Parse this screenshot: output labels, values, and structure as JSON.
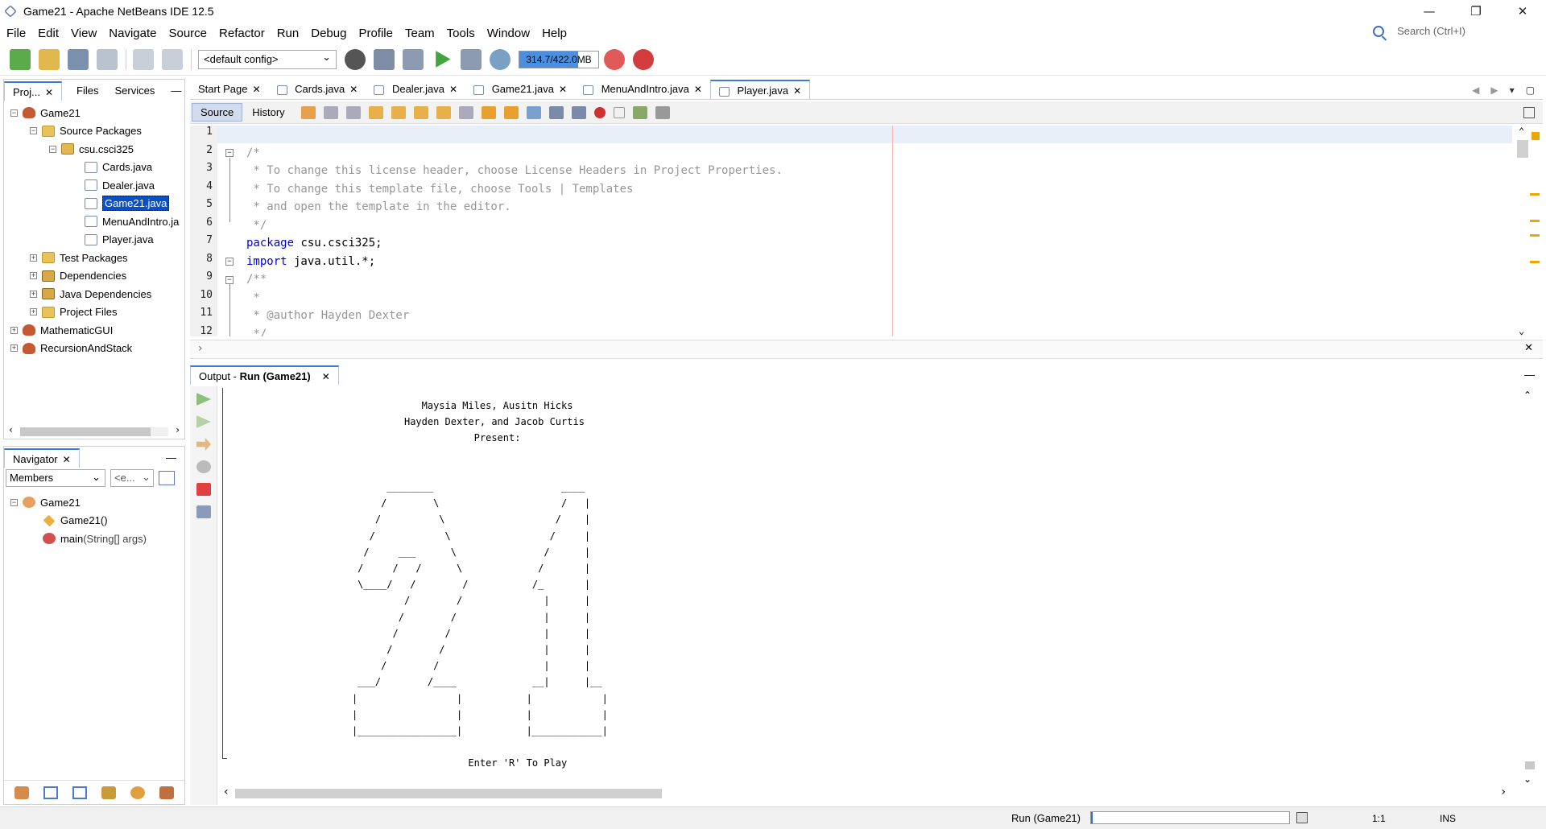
{
  "window": {
    "title": "Game21 - Apache NetBeans IDE 12.5",
    "minimize": "—",
    "maximize": "❐",
    "close": "✕"
  },
  "menu": [
    "File",
    "Edit",
    "View",
    "Navigate",
    "Source",
    "Refactor",
    "Run",
    "Debug",
    "Profile",
    "Team",
    "Tools",
    "Window",
    "Help"
  ],
  "search": {
    "placeholder": "Search (Ctrl+I)"
  },
  "toolbar": {
    "config": "<default config>",
    "memory_label": "314.7/422.0MB",
    "memory_fraction": 0.746
  },
  "project_tabs": {
    "projects": "Proj...",
    "files": "Files",
    "services": "Services",
    "minimize": "—"
  },
  "project_tree": {
    "root": "Game21",
    "source_packages": "Source Packages",
    "package": "csu.csci325",
    "files": [
      "Cards.java",
      "Dealer.java",
      "Game21.java",
      "MenuAndIntro.ja",
      "Player.java"
    ],
    "selected_file": "Game21.java",
    "nodes": [
      "Test Packages",
      "Dependencies",
      "Java Dependencies",
      "Project Files"
    ],
    "other_projects": [
      "MathematicGUI",
      "RecursionAndStack"
    ]
  },
  "navigator": {
    "tab": "Navigator",
    "members": "Members",
    "filter": "<e...",
    "class": "Game21",
    "items": [
      {
        "name": "Game21",
        "suffix": "()"
      },
      {
        "name": "main",
        "suffix": "(String[] args)"
      }
    ]
  },
  "editor_tabs": [
    "Start Page",
    "Cards.java",
    "Dealer.java",
    "Game21.java",
    "MenuAndIntro.java",
    "Player.java"
  ],
  "active_editor_tab": "Player.java",
  "source_toolbar": {
    "source": "Source",
    "history": "History"
  },
  "code_lines": [
    {
      "n": "1",
      "text": ""
    },
    {
      "n": "2",
      "text": "/*"
    },
    {
      "n": "3",
      "text": " * To change this license header, choose License Headers in Project Properties."
    },
    {
      "n": "4",
      "text": " * To change this template file, choose Tools | Templates"
    },
    {
      "n": "5",
      "text": " * and open the template in the editor."
    },
    {
      "n": "6",
      "text": " */"
    },
    {
      "n": "7",
      "kw": "package",
      "text": " csu.csci325;"
    },
    {
      "n": "8",
      "kw": "import",
      "text": " java.util.*;"
    },
    {
      "n": "9",
      "text": "/**"
    },
    {
      "n": "10",
      "text": " *"
    },
    {
      "n": "11",
      "text": " * @author Hayden Dexter"
    },
    {
      "n": "12",
      "text": " */"
    }
  ],
  "output": {
    "tab_prefix": "Output - ",
    "tab_name": "Run (Game21)",
    "close": "✕",
    "lines": [
      "                                  Maysia Miles, Ausitn Hicks",
      "                               Hayden Dexter, and Jacob Curtis",
      "                                           Present:",
      "",
      "",
      "                            ________                      ____",
      "                           /        \\                     /   |",
      "                          /          \\                   /    |",
      "                         /            \\                 /     |",
      "                        /     ___      \\               /      |",
      "                       /     /   /      \\             /       |",
      "                       \\____/   /        /           /_       |",
      "                               /        /              |      |",
      "                              /        /               |      |",
      "                             /        /                |      |",
      "                            /        /                 |      |",
      "                           /        /                  |      |",
      "                       ___/        /____             __|      |__",
      "                      |                 |           |            |",
      "                      |                 |           |            |",
      "                      |_________________|           |____________|",
      "",
      "                                          Enter 'R' To Play"
    ]
  },
  "status": {
    "run": "Run (Game21)",
    "position": "1:1",
    "mode": "INS"
  }
}
